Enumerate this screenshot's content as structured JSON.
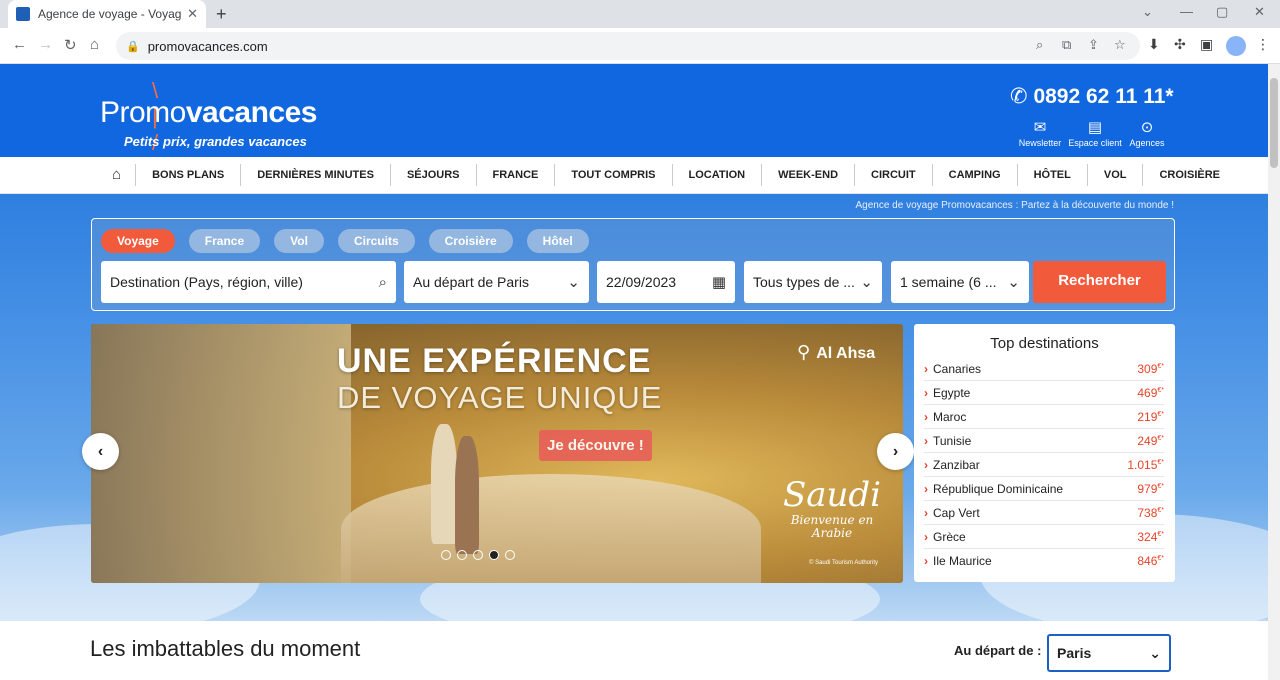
{
  "browser": {
    "tab_title": "Agence de voyage - Voyage pas cher",
    "tab_close": "✕",
    "new_tab": "+",
    "url": "promovacances.com",
    "window_controls": [
      "⌄",
      "—",
      "▢",
      "✕"
    ]
  },
  "header": {
    "brand_prefix": "Promo",
    "brand_suffix": "vacances",
    "tagline": "Petits prix, grandes vacances",
    "phone": "0892 62 11 11*",
    "links": [
      {
        "label": "Newsletter",
        "icon": "envelope-icon"
      },
      {
        "label": "Espace client",
        "icon": "briefcase-icon"
      },
      {
        "label": "Agences",
        "icon": "map-pin-icon"
      }
    ]
  },
  "menu": {
    "items": [
      "BONS PLANS",
      "DERNIÈRES MINUTES",
      "SÉJOURS",
      "FRANCE",
      "TOUT COMPRIS",
      "LOCATION",
      "WEEK-END",
      "CIRCUIT",
      "CAMPING",
      "HÔTEL",
      "VOL",
      "CROISIÈRE"
    ]
  },
  "hero": {
    "caption": "Agence de voyage Promovacances : Partez à la découverte du monde !",
    "search": {
      "tabs": [
        "Voyage",
        "France",
        "Vol",
        "Circuits",
        "Croisière",
        "Hôtel"
      ],
      "active_tab": "Voyage",
      "destination_placeholder": "Destination (Pays, région, ville)",
      "departure": "Au départ de Paris",
      "date": "22/09/2023",
      "types": "Tous types de ...",
      "duration": "1 semaine (6 ...",
      "submit": "Rechercher"
    },
    "promo": {
      "headline_1": "UNE EXPÉRIENCE",
      "headline_2": "DE VOYAGE UNIQUE",
      "cta": "Je découvre !",
      "location": "Al Ahsa",
      "brand": "Saudi",
      "brand_sub": "Bienvenue en Arabie",
      "credit": "© Saudi Tourism Authority",
      "slide_count": 5,
      "active_slide": 4
    },
    "top_destinations": {
      "title": "Top destinations",
      "currency": "€*",
      "items": [
        {
          "name": "Canaries",
          "price": "309"
        },
        {
          "name": "Egypte",
          "price": "469"
        },
        {
          "name": "Maroc",
          "price": "219"
        },
        {
          "name": "Tunisie",
          "price": "249"
        },
        {
          "name": "Zanzibar",
          "price": "1.015"
        },
        {
          "name": "République Dominicaine",
          "price": "979"
        },
        {
          "name": "Cap Vert",
          "price": "738"
        },
        {
          "name": "Grèce",
          "price": "324"
        },
        {
          "name": "Ile Maurice",
          "price": "846"
        }
      ]
    }
  },
  "section": {
    "title": "Les imbattables du moment",
    "departure_label": "Au départ de :",
    "departure_value": "Paris"
  },
  "colors": {
    "brand_blue": "#1067e0",
    "accent_orange": "#f25a3c",
    "price_red": "#e8432a"
  }
}
